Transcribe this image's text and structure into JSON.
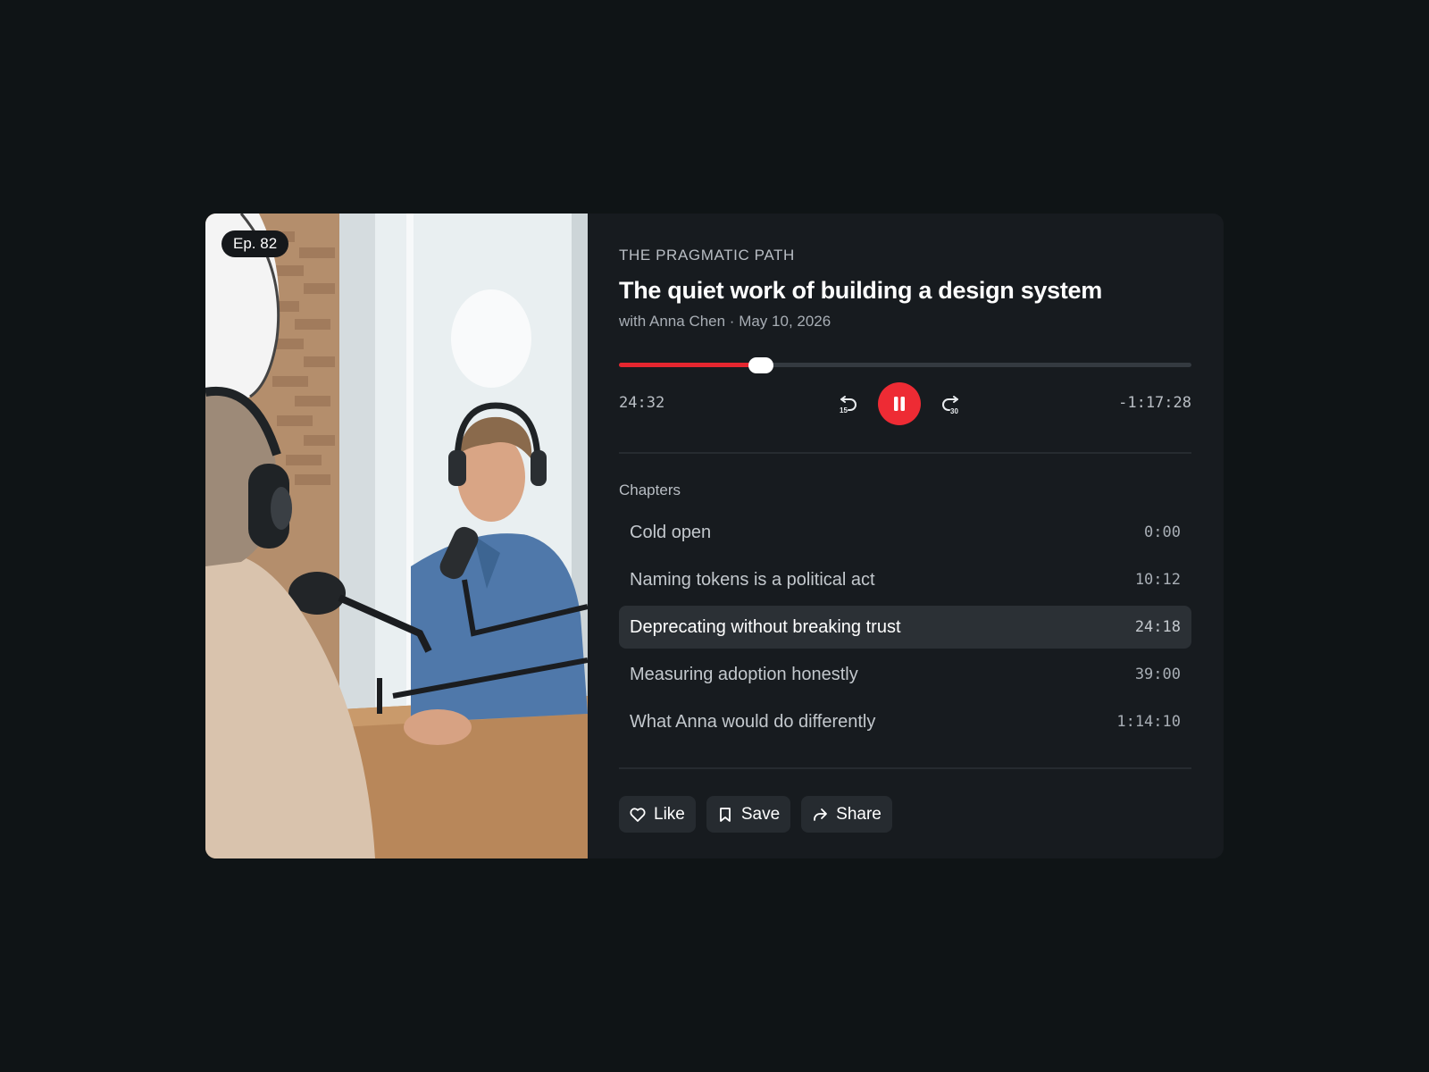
{
  "episode": {
    "badge": "Ep. 82",
    "show_name": "THE PRAGMATIC PATH",
    "title": "The quiet work of building a design system",
    "meta": "with Anna Chen · May 10, 2026"
  },
  "player": {
    "progress_fraction": 0.248,
    "elapsed": "24:32",
    "remaining": "-1:17:28",
    "state": "playing",
    "skip_back_seconds": "15",
    "skip_forward_seconds": "30",
    "accent_color": "#ee2b34"
  },
  "chapters": {
    "label": "Chapters",
    "items": [
      {
        "title": "Cold open",
        "time": "0:00",
        "active": false
      },
      {
        "title": "Naming tokens is a political act",
        "time": "10:12",
        "active": false
      },
      {
        "title": "Deprecating without breaking trust",
        "time": "24:18",
        "active": true
      },
      {
        "title": "Measuring adoption honestly",
        "time": "39:00",
        "active": false
      },
      {
        "title": "What Anna would do differently",
        "time": "1:14:10",
        "active": false
      }
    ]
  },
  "actions": [
    {
      "label": "Like",
      "icon": "heart-icon"
    },
    {
      "label": "Save",
      "icon": "bookmark-icon"
    },
    {
      "label": "Share",
      "icon": "share-icon"
    }
  ]
}
